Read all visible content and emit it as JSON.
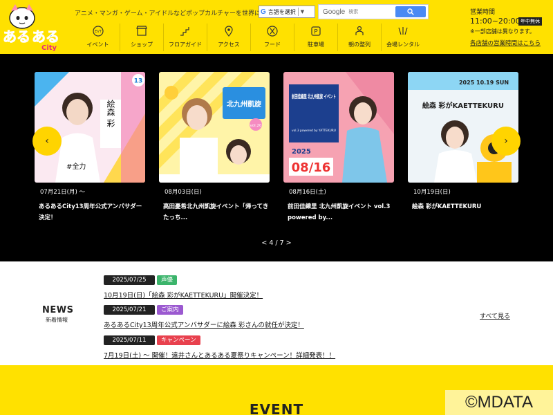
{
  "header": {
    "tagline": "アニメ・マンガ・ゲーム・アイドルなどポップカルチャーを世界に発信！",
    "logo_text": "あるあるCity",
    "translate_label": "言語を選択",
    "search_brand": "Google",
    "search_placeholder": "検索",
    "hours_label": "営業時間",
    "hours_time": "11:00~20:00",
    "hours_badge": "年中無休",
    "hours_note": "※一部店舗は異なります。",
    "hours_link": "各店舗の営業時間はこちら"
  },
  "nav": [
    {
      "label": "イベント",
      "icon": "ticket-icon"
    },
    {
      "label": "ショップ",
      "icon": "shop-icon"
    },
    {
      "label": "フロアガイド",
      "icon": "stairs-icon"
    },
    {
      "label": "アクセス",
      "icon": "map-pin-icon"
    },
    {
      "label": "フード",
      "icon": "food-icon"
    },
    {
      "label": "駐車場",
      "icon": "parking-icon"
    },
    {
      "label": "朝の整列",
      "icon": "queue-icon"
    },
    {
      "label": "会場レンタル",
      "icon": "venue-icon"
    }
  ],
  "carousel": {
    "pager": "< 4 / 7 >",
    "prev_icon": "chevron-left-icon",
    "next_icon": "chevron-right-icon",
    "slides": [
      {
        "date": "07月21日(月) ～",
        "title": "あるあるCity13周年公式アンバサダー決定！",
        "name_text": "絵森 彩",
        "badge": "13"
      },
      {
        "date": "08月03日(日)",
        "title": "高田憂希北九州凱旋イベント「帰ってきたっち...",
        "banner_text": "北九州凱旋",
        "vol": "vol.20"
      },
      {
        "date": "08月16日(土)",
        "title": "前田佳織里 北九州凱旋イベント vol.3 powered by...",
        "poster_title": "前田佳織里 北九州凱旋 イベント",
        "poster_date_year": "2025",
        "poster_date_md": "08/16",
        "poster_sub": "vol.3 powered by YATTEKURU"
      },
      {
        "date": "10月19日(日)",
        "title": "絵森 彩がKAETTEKURU",
        "poster_date": "2025 10.19 SUN",
        "poster_name": "絵森 彩がKAETTEKURU"
      }
    ]
  },
  "news": {
    "title": "NEWS",
    "subtitle": "新着情報",
    "see_all": "すべて見る",
    "items": [
      {
        "date": "2025/07/25",
        "category": "声優",
        "cat_color": "#3bb46b",
        "text": "10月19日(日)「絵森 彩がKAETTEKURU」開催決定！"
      },
      {
        "date": "2025/07/21",
        "category": "ご案内",
        "cat_color": "#9b59d0",
        "text": "あるあるCity13周年公式アンバサダーに絵森 彩さんの就任が決定！"
      },
      {
        "date": "2025/07/11",
        "category": "キャンペーン",
        "cat_color": "#e8414e",
        "text": "7月19日(土) ～ 開催！遠井さんとあるある夏祭りキャンペーン！詳細発表！！"
      }
    ]
  },
  "event": {
    "title": "EVENT"
  },
  "watermark": "©MDATA",
  "colors": {
    "brand_yellow": "#ffe100",
    "arrow_yellow": "#ffd400",
    "carousel_bg": "#000000"
  }
}
